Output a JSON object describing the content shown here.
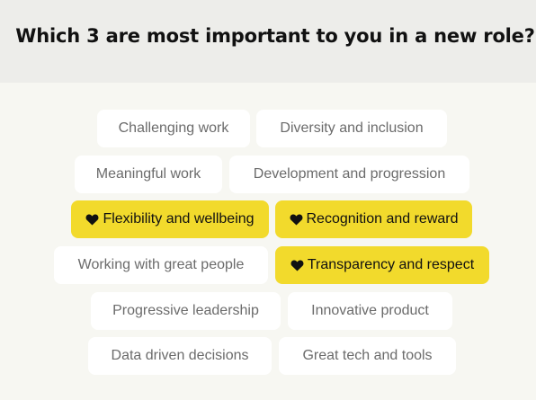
{
  "question": "Which 3 are most important to you in a new role?",
  "options": [
    {
      "label": "Challenging work",
      "selected": false
    },
    {
      "label": "Diversity and inclusion",
      "selected": false
    },
    {
      "label": "Meaningful work",
      "selected": false
    },
    {
      "label": "Development and progression",
      "selected": false
    },
    {
      "label": "Flexibility and wellbeing",
      "selected": true
    },
    {
      "label": "Recognition and reward",
      "selected": true
    },
    {
      "label": "Working with great people",
      "selected": false
    },
    {
      "label": "Transparency and respect",
      "selected": true
    },
    {
      "label": "Progressive leadership",
      "selected": false
    },
    {
      "label": "Innovative product",
      "selected": false
    },
    {
      "label": "Data driven decisions",
      "selected": false
    },
    {
      "label": "Great tech and tools",
      "selected": false
    }
  ],
  "colors": {
    "selected_background": "#f2da2c",
    "unselected_background": "#ffffff",
    "page_background": "#f7f7f2",
    "header_background": "#ededea"
  },
  "icons": {
    "selected_marker": "heart-icon"
  }
}
